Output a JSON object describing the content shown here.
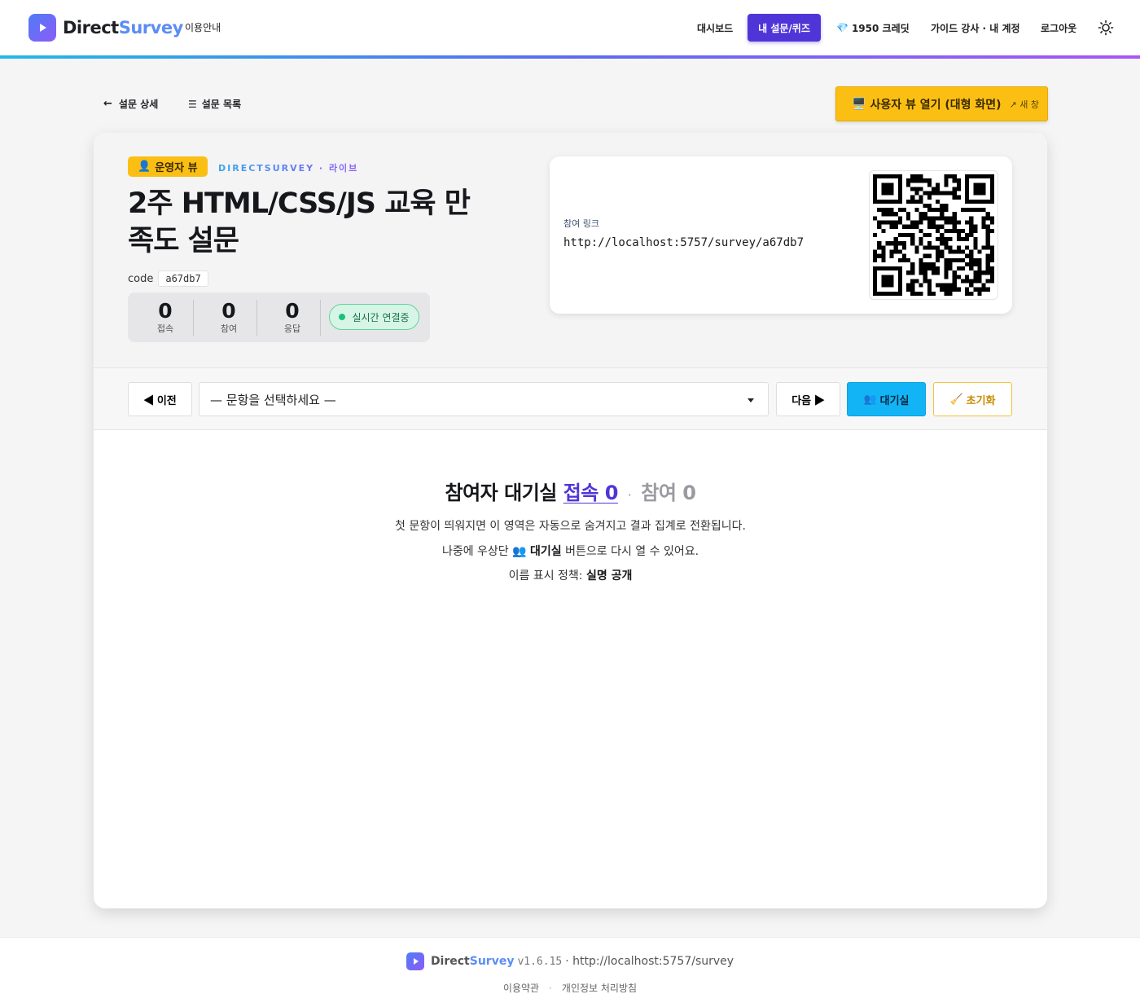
{
  "header": {
    "brand_part1": "Direct",
    "brand_part2": "Survey",
    "guide": "이용안내",
    "nav_dashboard": "대시보드",
    "nav_my_surveys": "내 설문/퀴즈",
    "nav_credits": "1950 크레딧",
    "nav_guide_account": "가이드 강사 · 내 계정",
    "nav_logout": "로그아웃",
    "accent_color": "#4f35d8"
  },
  "subnav": {
    "back_label": "설문 상세",
    "list_label": "설문 목록",
    "open_user_view": "사용자 뷰 열기 (대형 화면)",
    "new_window": "↗ 새 창"
  },
  "survey": {
    "operator_badge": "운영자 뷰",
    "brand_tag": "DIRECTSURVEY · 라이브",
    "title": "2주 HTML/CSS/JS 교육 만족도 설문",
    "code_label": "code",
    "code": "a67db7",
    "stats": [
      {
        "value": "0",
        "label": "접속"
      },
      {
        "value": "0",
        "label": "참여"
      },
      {
        "value": "0",
        "label": "응답"
      }
    ],
    "live_status": "실시간 연결중",
    "link_label": "참여 링크",
    "link_url": "http://localhost:5757/survey/a67db7"
  },
  "controls": {
    "prev": "◀ 이전",
    "select_placeholder": "— 문항을 선택하세요 —",
    "next": "다음 ▶",
    "waiting_room": "대기실",
    "reset": "초기화"
  },
  "waiting": {
    "title": "참여자 대기실",
    "connected": "접속 0",
    "separator": "·",
    "participating": "참여 0",
    "line1": "첫 문항이 띄워지면 이 영역은 자동으로 숨겨지고 결과 집계로 전환됩니다.",
    "line2_pre": "나중에 우상단",
    "line2_bold": "대기실",
    "line2_post": "버튼으로 다시 열 수 있어요.",
    "line3_pre": "이름 표시 정책:",
    "line3_bold": "실명 공개"
  },
  "footer": {
    "brand_part1": "Direct",
    "brand_part2": "Survey",
    "version": "v1.6.15",
    "url": "· http://localhost:5757/survey",
    "terms": "이용약관",
    "separator": "·",
    "privacy": "개인정보 처리방침"
  },
  "icons": {
    "logo": "play-icon",
    "gem": "gem-icon",
    "theme": "sun-icon",
    "back": "arrow-left-icon",
    "list": "list-icon",
    "monitor": "monitor-icon",
    "operator": "user-icon",
    "people": "people-icon",
    "broom": "broom-icon"
  }
}
